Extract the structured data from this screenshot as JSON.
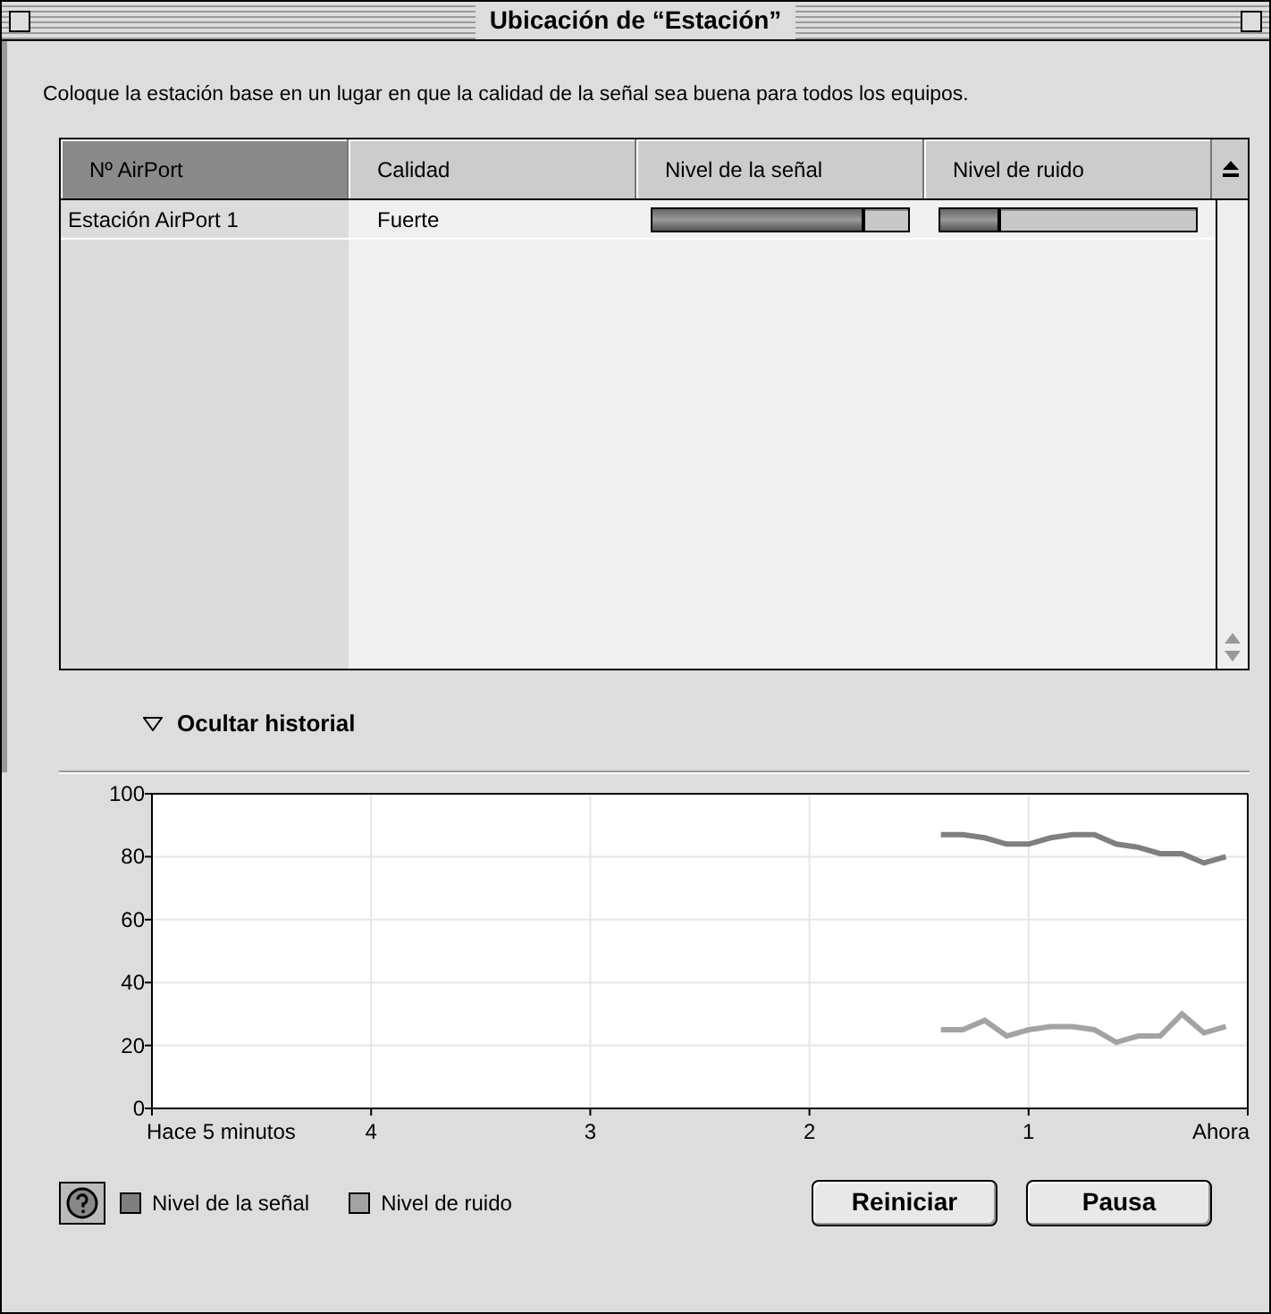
{
  "window": {
    "title": "Ubicación de “Estación”"
  },
  "instructions": "Coloque la estación base en un lugar en que la calidad de la señal sea buena para todos los equipos.",
  "table": {
    "columns": [
      {
        "label": "Nº AirPort",
        "selected": true
      },
      {
        "label": "Calidad",
        "selected": false
      },
      {
        "label": "Nivel de la señal",
        "selected": false
      },
      {
        "label": "Nivel de ruido",
        "selected": false
      }
    ],
    "rows": [
      {
        "name": "Estación AirPort 1",
        "quality": "Fuerte",
        "signal": {
          "level": 0.83
        },
        "noise": {
          "level": 0.24
        }
      }
    ]
  },
  "history_toggle": {
    "label": "Ocultar historial",
    "expanded": true
  },
  "chart_data": {
    "type": "line",
    "grid": true,
    "xlim": [
      -5,
      0
    ],
    "ylim": [
      0,
      100
    ],
    "xticks": [
      {
        "value": -5,
        "label": "Hace 5 minutos"
      },
      {
        "value": -4,
        "label": "4"
      },
      {
        "value": -3,
        "label": "3"
      },
      {
        "value": -2,
        "label": "2"
      },
      {
        "value": -1,
        "label": "1"
      },
      {
        "value": 0,
        "label": "Ahora"
      }
    ],
    "yticks": [
      0,
      20,
      40,
      60,
      80,
      100
    ],
    "x": [
      -1.4,
      -1.3,
      -1.2,
      -1.1,
      -1.0,
      -0.9,
      -0.8,
      -0.7,
      -0.6,
      -0.5,
      -0.4,
      -0.3,
      -0.2,
      -0.1
    ],
    "series": [
      {
        "name": "Nivel de la señal",
        "color": "#7f7f7f",
        "values": [
          87,
          87,
          86,
          84,
          84,
          86,
          87,
          87,
          84,
          83,
          81,
          81,
          78,
          80
        ]
      },
      {
        "name": "Nivel de ruido",
        "color": "#a3a3a3",
        "values": [
          25,
          25,
          28,
          23,
          25,
          26,
          26,
          25,
          21,
          23,
          23,
          30,
          24,
          26
        ]
      }
    ]
  },
  "buttons": [
    "Reiniciar",
    "Pausa"
  ]
}
